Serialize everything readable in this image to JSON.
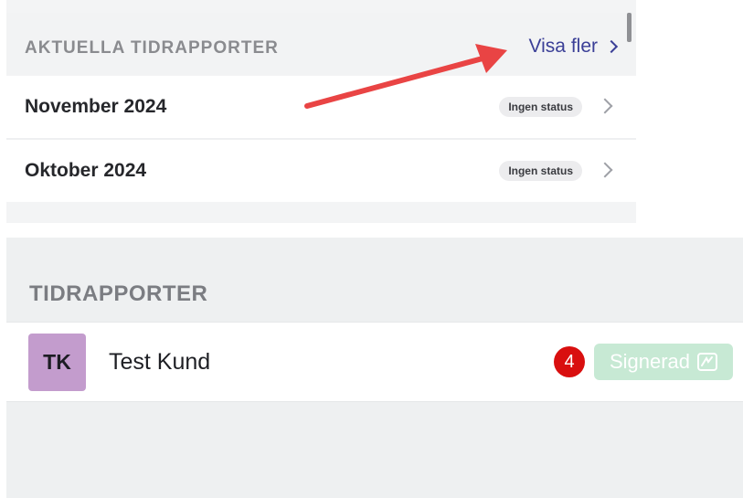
{
  "recent": {
    "title": "AKTUELLA TIDRAPPORTER",
    "more_label": "Visa fler",
    "items": [
      {
        "label": "November 2024",
        "status": "Ingen status"
      },
      {
        "label": "Oktober 2024",
        "status": "Ingen status"
      }
    ]
  },
  "reports": {
    "title": "TIDRAPPORTER",
    "customer": {
      "initials": "TK",
      "name": "Test Kund",
      "count": "4",
      "status": "Signerad",
      "avatar_color": "#c39ccd",
      "status_color": "#c7e9d4"
    }
  },
  "annotation": {
    "arrow_color": "#e94444",
    "points_to": "Visa fler"
  },
  "icons": {
    "row_chevron": "chevron-right-icon",
    "signed_icon": "signature-icon"
  }
}
